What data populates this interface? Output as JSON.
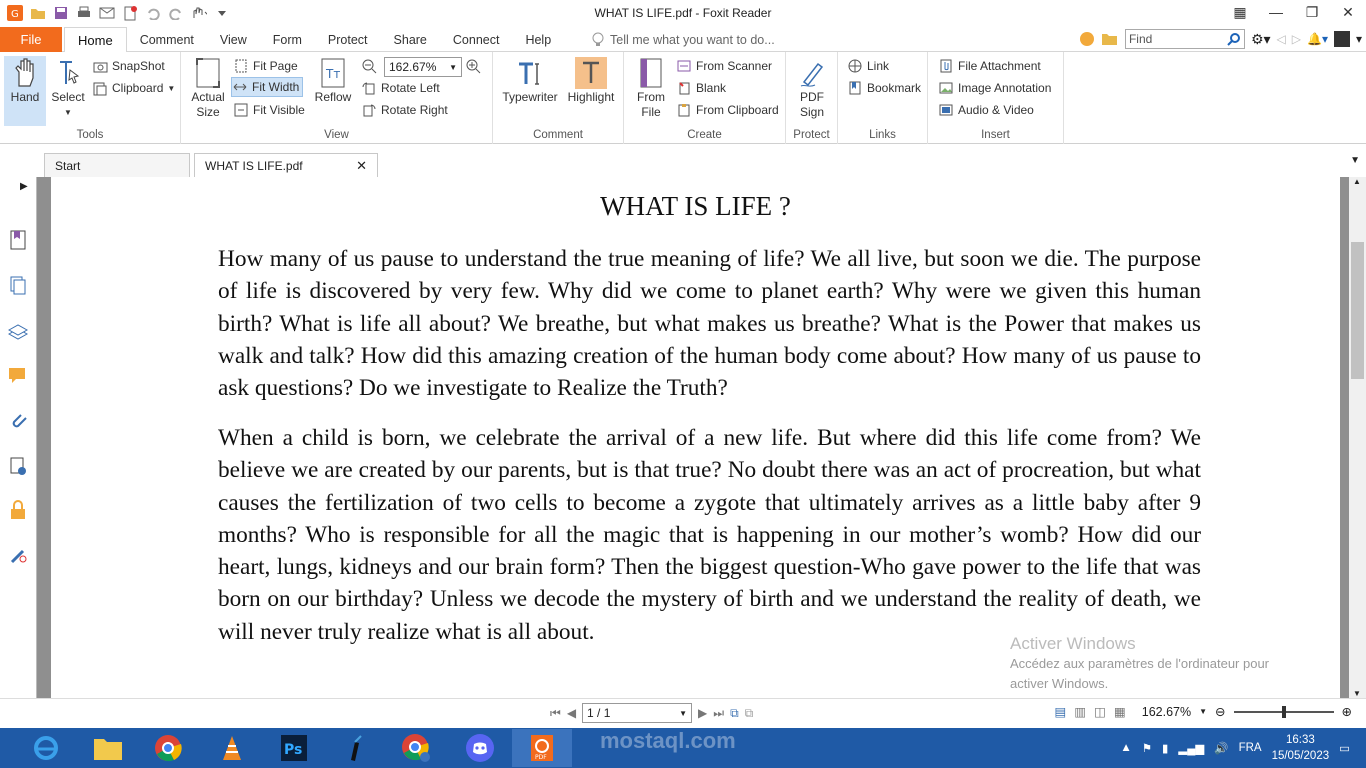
{
  "window": {
    "title": "WHAT IS LIFE.pdf - Foxit Reader"
  },
  "menu": {
    "file": "File",
    "tabs": [
      "Home",
      "Comment",
      "View",
      "Form",
      "Protect",
      "Share",
      "Connect",
      "Help"
    ],
    "tell_me": "Tell me what you want to do...",
    "find_placeholder": "Find"
  },
  "ribbon": {
    "tools": {
      "label": "Tools",
      "hand": "Hand",
      "select": "Select",
      "snapshot": "SnapShot",
      "clipboard": "Clipboard"
    },
    "view": {
      "label": "View",
      "actual_size_1": "Actual",
      "actual_size_2": "Size",
      "fit_page": "Fit Page",
      "fit_width": "Fit Width",
      "fit_visible": "Fit Visible",
      "reflow": "Reflow",
      "zoom": "162.67%",
      "rotate_left": "Rotate Left",
      "rotate_right": "Rotate Right"
    },
    "comment": {
      "label": "Comment",
      "typewriter": "Typewriter",
      "highlight": "Highlight"
    },
    "create": {
      "label": "Create",
      "from_file_1": "From",
      "from_file_2": "File",
      "from_scanner": "From Scanner",
      "blank": "Blank",
      "from_clipboard": "From Clipboard"
    },
    "protect": {
      "label": "Protect",
      "pdf_sign_1": "PDF",
      "pdf_sign_2": "Sign"
    },
    "links": {
      "label": "Links",
      "link": "Link",
      "bookmark": "Bookmark"
    },
    "insert": {
      "label": "Insert",
      "file_attachment": "File Attachment",
      "image_annotation": "Image Annotation",
      "audio_video": "Audio & Video"
    }
  },
  "doc_tabs": {
    "start": "Start",
    "current": "WHAT IS LIFE.pdf"
  },
  "document": {
    "title": "WHAT IS LIFE ?",
    "paragraph1": "How many of us pause to understand the true meaning of life? We all live, but soon we die. The purpose of life is discovered by very few. Why did we come to planet earth? Why were we given this human birth? What is life all about? We breathe, but what makes us breathe? What is the Power that makes us walk and talk? How did this amazing creation of the human body come about? How many of us pause to ask questions? Do we investigate to Realize the Truth?",
    "paragraph2": "When a child is born, we celebrate the arrival of a new life. But where did this life come from? We believe we are created by our parents, but is that true? No doubt there was an act of procreation, but what causes the fertilization of two cells to become a zygote that ultimately arrives as a little baby after 9 months? Who is responsible for all the magic that is happening in our mother’s womb? How did our heart, lungs, kidneys and our brain form? Then the biggest question-Who gave power to the life that was born on our birthday? Unless we decode the mystery of birth and we understand the reality of death, we will never truly realize what is all about."
  },
  "activation": {
    "title": "Activer Windows",
    "line1": "Accédez aux paramètres de l'ordinateur pour",
    "line2": "activer Windows."
  },
  "status": {
    "page": "1 / 1",
    "zoom": "162.67%"
  },
  "taskbar": {
    "language": "FRA",
    "time": "16:33",
    "date": "15/05/2023",
    "brand": "mostaql.com"
  }
}
